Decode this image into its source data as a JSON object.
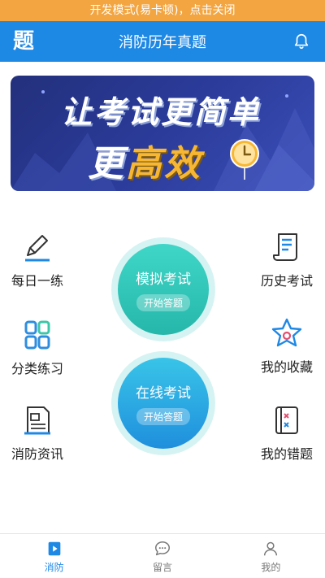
{
  "dev_bar": {
    "text": "开发模式(易卡顿)，点击关闭"
  },
  "header": {
    "logo": "题",
    "title": "消防历年真题",
    "bell_icon": "bell-icon"
  },
  "banner": {
    "line1": "让考试更简单",
    "line2_white": "更",
    "line2_yellow": "高效",
    "clock_icon": "clock-icon"
  },
  "left_items": [
    {
      "label": "每日一练",
      "icon": "pencil-icon"
    },
    {
      "label": "分类练习",
      "icon": "grid-icon"
    },
    {
      "label": "消防资讯",
      "icon": "news-icon"
    }
  ],
  "right_items": [
    {
      "label": "历史考试",
      "icon": "scroll-icon"
    },
    {
      "label": "我的收藏",
      "icon": "star-icon"
    },
    {
      "label": "我的错题",
      "icon": "wrong-notebook-icon"
    }
  ],
  "center": [
    {
      "title": "模拟考试",
      "action": "开始答题"
    },
    {
      "title": "在线考试",
      "action": "开始答题"
    }
  ],
  "tabs": [
    {
      "label": "消防",
      "icon": "exam-doc-icon",
      "active": true
    },
    {
      "label": "留言",
      "icon": "chat-icon",
      "active": false
    },
    {
      "label": "我的",
      "icon": "user-icon",
      "active": false
    }
  ],
  "colors": {
    "primary": "#1e88e5",
    "dev_bar": "#f2a541",
    "accent_yellow": "#f7b733",
    "teal": "#25b7aa"
  }
}
